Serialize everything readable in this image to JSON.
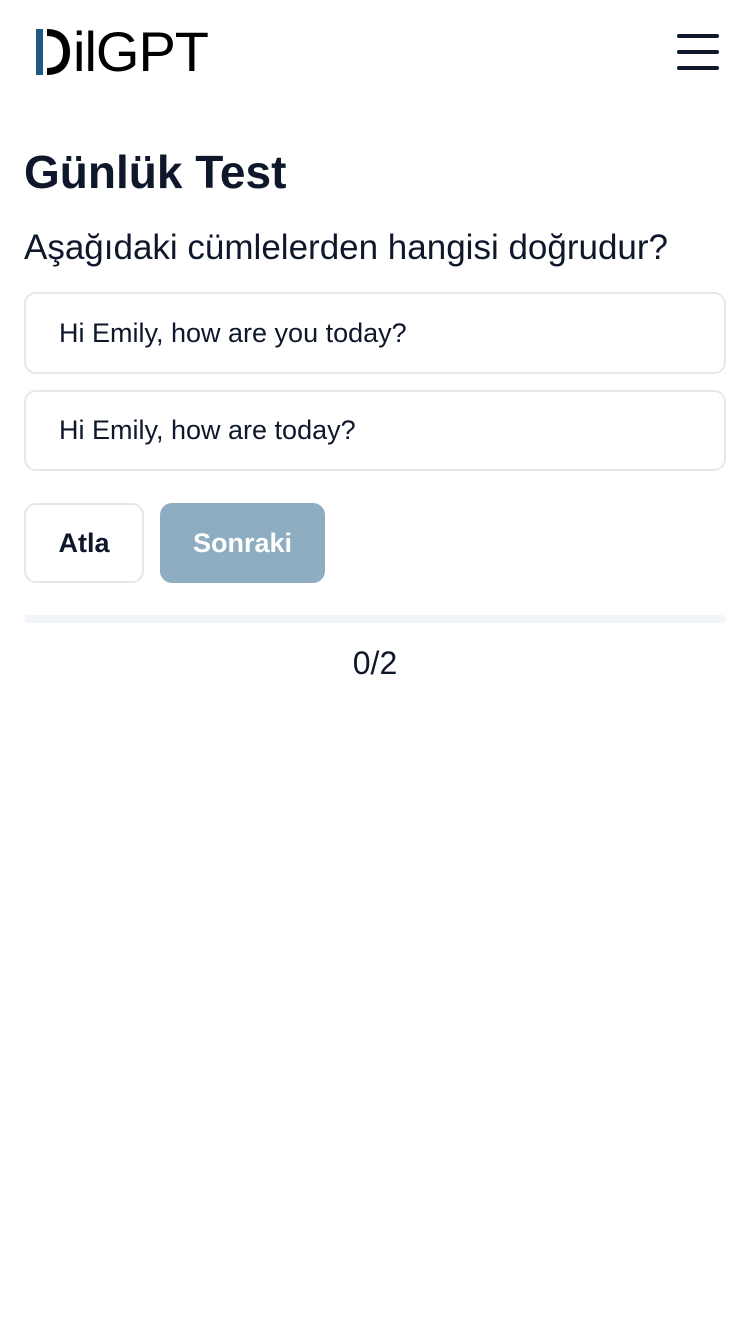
{
  "header": {
    "logo_text": "ilGPT",
    "logo_accent_color": "#1e5a84",
    "menu_icon": "hamburger-menu-icon"
  },
  "page": {
    "title": "Günlük Test",
    "question": "Aşağıdaki cümlelerden hangisi doğrudur?"
  },
  "options": [
    {
      "label": "Hi Emily, how are you today?"
    },
    {
      "label": "Hi Emily, how are today?"
    }
  ],
  "actions": {
    "skip_label": "Atla",
    "next_label": "Sonraki",
    "next_color": "#8eadc1"
  },
  "progress": {
    "current": 0,
    "total": 2,
    "text": "0/2",
    "fraction": 0
  }
}
